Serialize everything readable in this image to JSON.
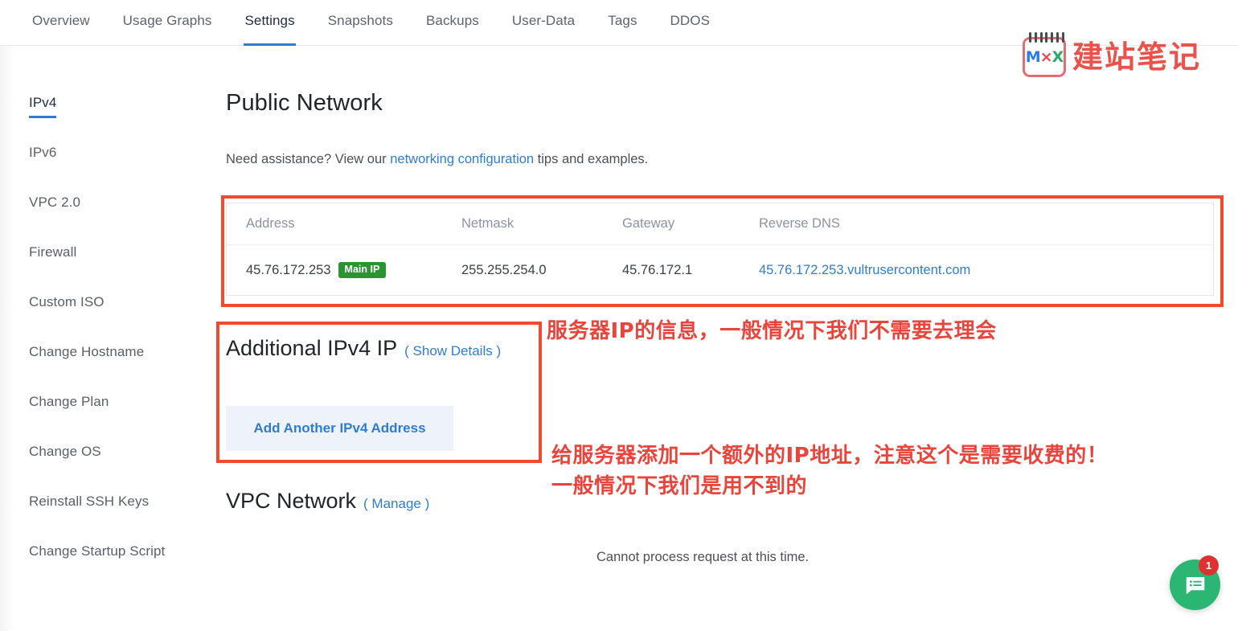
{
  "tabs": [
    {
      "label": "Overview",
      "active": false
    },
    {
      "label": "Usage Graphs",
      "active": false
    },
    {
      "label": "Settings",
      "active": true
    },
    {
      "label": "Snapshots",
      "active": false
    },
    {
      "label": "Backups",
      "active": false
    },
    {
      "label": "User-Data",
      "active": false
    },
    {
      "label": "Tags",
      "active": false
    },
    {
      "label": "DDOS",
      "active": false
    }
  ],
  "watermark": {
    "icon": "notebook-icon",
    "mark_m": "M",
    "mark_d": "×",
    "mark_x": "X",
    "text": "建站笔记"
  },
  "sidebar": {
    "items": [
      {
        "label": "IPv4",
        "active": true
      },
      {
        "label": "IPv6",
        "active": false
      },
      {
        "label": "VPC 2.0",
        "active": false
      },
      {
        "label": "Firewall",
        "active": false
      },
      {
        "label": "Custom ISO",
        "active": false
      },
      {
        "label": "Change Hostname",
        "active": false
      },
      {
        "label": "Change Plan",
        "active": false
      },
      {
        "label": "Change OS",
        "active": false
      },
      {
        "label": "Reinstall SSH Keys",
        "active": false
      },
      {
        "label": "Change Startup Script",
        "active": false
      }
    ]
  },
  "main": {
    "title": "Public Network",
    "helper_prefix": "Need assistance? View our ",
    "helper_link": "networking configuration",
    "helper_suffix": " tips and examples.",
    "table": {
      "headers": [
        "Address",
        "Netmask",
        "Gateway",
        "Reverse DNS"
      ],
      "rows": [
        {
          "address": "45.76.172.253",
          "badge": "Main IP",
          "netmask": "255.255.254.0",
          "gateway": "45.76.172.1",
          "reverse_dns": "45.76.172.253.vultrusercontent.com"
        }
      ]
    },
    "additional_ipv4": {
      "title": "Additional IPv4 IP",
      "show_details": "( Show Details )",
      "add_button": "Add Another IPv4 Address"
    },
    "vpc": {
      "title": "VPC Network",
      "manage": "( Manage )",
      "status": "Cannot process request at this time."
    }
  },
  "annotations": [
    {
      "id": "annotation-ip-info",
      "text": "服务器IP的信息，一般情况下我们不需要去理会"
    },
    {
      "id": "annotation-additional-ip-line1",
      "text": "给服务器添加一个额外的IP地址，注意这个是需要收费的！"
    },
    {
      "id": "annotation-additional-ip-line2",
      "text": "一般情况下我们是用不到的"
    }
  ],
  "chat_widget": {
    "icon": "chat-message-icon",
    "unread_count": "1"
  },
  "colors": {
    "accent_blue": "#2f7dd1",
    "annotation_red": "#e8453c",
    "highlight_box_red": "#f04a32",
    "badge_green": "#2a9530",
    "chat_green": "#2bb673",
    "badge_red": "#e03131"
  }
}
